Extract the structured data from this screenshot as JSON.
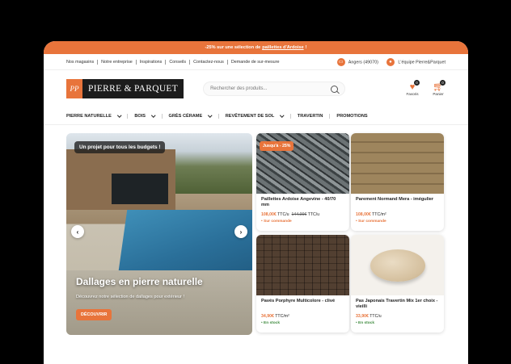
{
  "promo_bar": {
    "prefix": "-25% sur une sélection de",
    "link": "paillettes d'Ardoise",
    "suffix": "!"
  },
  "topbar": {
    "links": [
      "Nos magasins",
      "Notre entreprise",
      "Inspirations",
      "Conseils",
      "Contactez-nous",
      "Demande de sur-mesure"
    ],
    "store": "Angers (49070)",
    "account": "L'équipe Pierre&Parquet"
  },
  "header": {
    "logo_mark": "PP",
    "logo_name": "PIERRE & PARQUET",
    "search_placeholder": "Rechercher des produits...",
    "favorites_label": "Favoris",
    "favorites_count": "0",
    "cart_label": "Panier",
    "cart_count": "0"
  },
  "nav": [
    {
      "label": "PIERRE NATURELLE",
      "has_menu": true
    },
    {
      "label": "BOIS",
      "has_menu": true
    },
    {
      "label": "GRÈS CÉRAME",
      "has_menu": true
    },
    {
      "label": "REVÊTEMENT DE SOL",
      "has_menu": true
    },
    {
      "label": "TRAVERTIN",
      "has_menu": false
    },
    {
      "label": "PROMOTIONS",
      "has_menu": false
    }
  ],
  "hero": {
    "tag": "Un projet pour tous les budgets !",
    "title": "Dallages en pierre naturelle",
    "subtitle": "Découvrez notre sélection de dallages pour extérieur !",
    "cta": "DÉCOUVRIR",
    "prev": "‹",
    "next": "›"
  },
  "products": [
    {
      "name": "Paillettes Ardoise Angevine - 40/70 mm",
      "price": "108,00€",
      "unit": "TTC/u",
      "old_price": "144,00€",
      "old_unit": "TTC/u",
      "badge": "Jusqu'à - 25%",
      "stock": "• Sur commande",
      "stock_status": "orange"
    },
    {
      "name": "Parement Normand Mera - imégulier",
      "price": "108,00€",
      "unit": "TTC/m²",
      "old_price": "",
      "old_unit": "",
      "badge": "",
      "stock": "• Sur commande",
      "stock_status": "orange"
    },
    {
      "name": "Pavés Porphyre Multicolore - clivé",
      "price": "34,90€",
      "unit": "TTC/m²",
      "old_price": "",
      "old_unit": "",
      "badge": "",
      "stock": "• En stock",
      "stock_status": "green"
    },
    {
      "name": "Pas Japonais Travertin Mix 1er choix - vieilli",
      "price": "33,90€",
      "unit": "TTC/u",
      "old_price": "",
      "old_unit": "",
      "badge": "",
      "stock": "• En stock",
      "stock_status": "green"
    }
  ],
  "colors": {
    "accent": "#e8743b",
    "dark": "#1c1c1c",
    "in_stock": "#3d8a3d"
  }
}
